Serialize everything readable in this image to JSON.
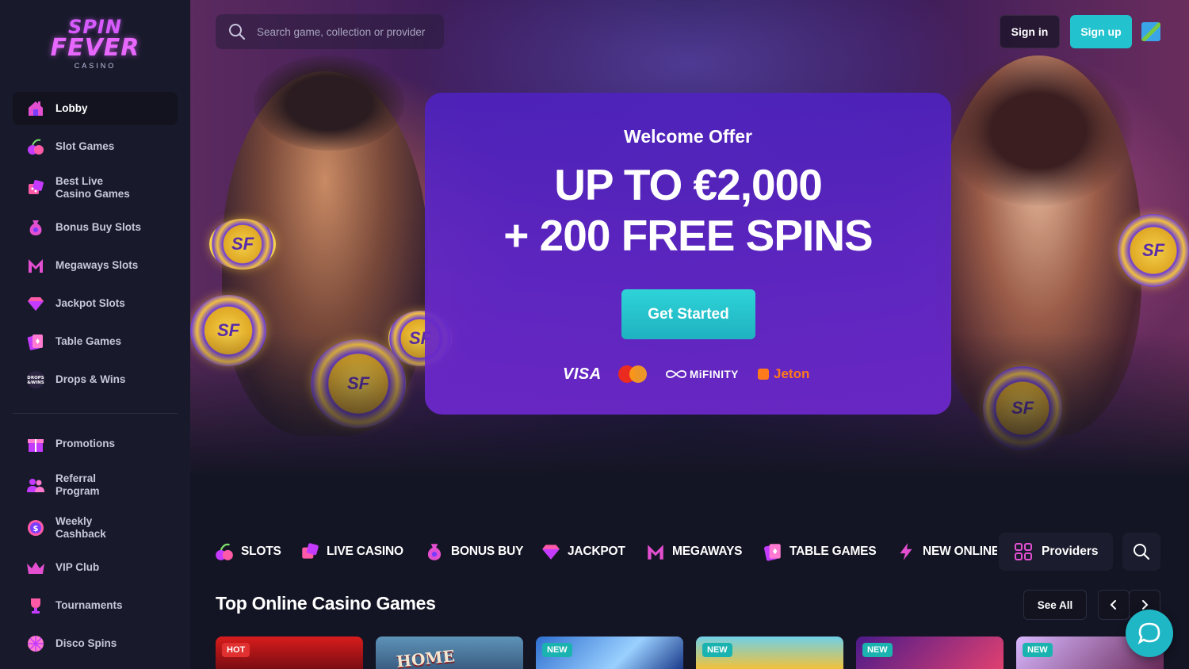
{
  "brand": {
    "logo_line1": "SPIN",
    "logo_line2": "FEVER",
    "logo_line3": "CASINO"
  },
  "sidebar": {
    "items": [
      {
        "label": "Lobby",
        "icon": "house-icon"
      },
      {
        "label": "Slot Games",
        "icon": "cherry-icon"
      },
      {
        "label": "Best Live Casino Games",
        "icon": "dice-icon"
      },
      {
        "label": "Bonus Buy Slots",
        "icon": "money-bag-icon"
      },
      {
        "label": "Megaways Slots",
        "icon": "megaways-m-icon"
      },
      {
        "label": "Jackpot Slots",
        "icon": "diamond-icon"
      },
      {
        "label": "Table Games",
        "icon": "playing-cards-icon"
      },
      {
        "label": "Drops & Wins",
        "icon": "drops-wins-icon"
      }
    ],
    "secondary": [
      {
        "label": "Promotions",
        "icon": "gift-icon"
      },
      {
        "label": "Referral Program",
        "icon": "users-icon"
      },
      {
        "label": "Weekly Cashback",
        "icon": "dollar-coin-icon"
      },
      {
        "label": "VIP Club",
        "icon": "crown-icon"
      },
      {
        "label": "Tournaments",
        "icon": "trophy-icon"
      },
      {
        "label": "Disco Spins",
        "icon": "disco-ball-icon"
      }
    ]
  },
  "header": {
    "search_placeholder": "Search game, collection or provider",
    "signin_label": "Sign in",
    "signup_label": "Sign up"
  },
  "hero": {
    "kicker": "Welcome Offer",
    "line1": "UP TO €2,000",
    "line2": "+ 200 FREE SPINS",
    "cta_label": "Get Started",
    "chip_text": "SF",
    "payments": {
      "visa": "VISA",
      "mifinity": "MiFINITY",
      "jeton": "Jeton"
    }
  },
  "categories": [
    {
      "label": "SLOTS",
      "icon": "cherry-icon"
    },
    {
      "label": "LIVE CASINO",
      "icon": "dice-icon"
    },
    {
      "label": "BONUS BUY",
      "icon": "money-bag-icon"
    },
    {
      "label": "JACKPOT",
      "icon": "diamond-icon"
    },
    {
      "label": "MEGAWAYS",
      "icon": "megaways-m-icon"
    },
    {
      "label": "TABLE GAMES",
      "icon": "playing-cards-icon"
    },
    {
      "label": "NEW ONLINE",
      "icon": "lightning-icon"
    }
  ],
  "providers_label": "Providers",
  "section": {
    "title": "Top Online Casino Games",
    "see_all_label": "See All"
  },
  "games": [
    {
      "badge": "HOT",
      "title": "",
      "badge_color": "#e0302f"
    },
    {
      "badge": "",
      "title": "HOME",
      "badge_color": ""
    },
    {
      "badge": "NEW",
      "title": "",
      "badge_color": "#1bb3b0"
    },
    {
      "badge": "NEW",
      "title": "",
      "badge_color": "#1bb3b0"
    },
    {
      "badge": "NEW",
      "title": "",
      "badge_color": "#1bb3b0"
    },
    {
      "badge": "NEW",
      "title": "",
      "badge_color": "#1bb3b0"
    }
  ],
  "colors": {
    "accent_cyan": "#22c3cf",
    "accent_pink": "#e868ff",
    "background": "#141524",
    "sidebar": "#181a2b"
  }
}
